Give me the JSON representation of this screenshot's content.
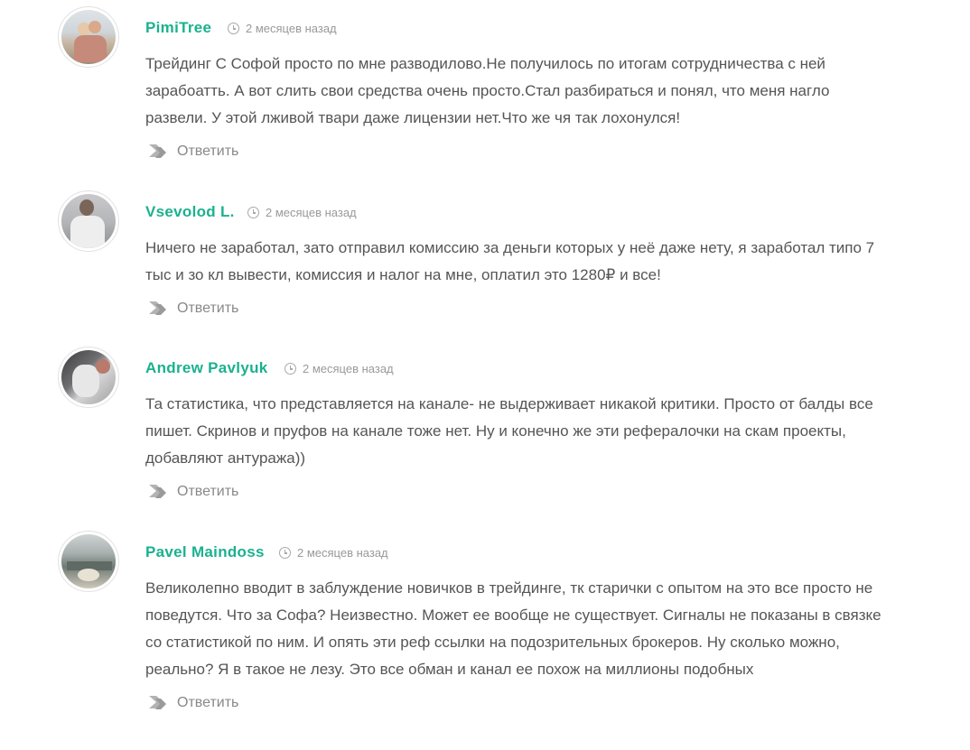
{
  "comments": [
    {
      "author": "PimiTree",
      "time": "2 месяцев назад",
      "text": "Трейдинг С Софой просто по мне разводилово.Не получилось по итогам сотрудничества с ней зарабоатть. А вот слить свои средства очень просто.Стал разбираться и понял, что меня нагло развели. У этой лживой твари даже лицензии нет.Что же чя так лохонулся!",
      "reply_label": "Ответить",
      "avatar_icon": "user-photo-avatar"
    },
    {
      "author": "Vsevolod L.",
      "time": "2 месяцев назад",
      "text": "Ничего не заработал, зато отправил комиссию за деньги которых у неё даже нету, я заработал типо 7 тыс и зо кл вывести, комиссия и налог на мне, оплатил это 1280₽ и все!",
      "reply_label": "Ответить",
      "avatar_icon": "user-photo-avatar"
    },
    {
      "author": "Andrew Pavlyuk",
      "time": "2 месяцев назад",
      "text": "Та статистика, что представляется на канале- не выдерживает никакой критики. Просто от балды все пишет. Скринов и пруфов на канале тоже нет. Ну и конечно же эти рефералочки на скам проекты, добавляют антуража))",
      "reply_label": "Ответить",
      "avatar_icon": "user-photo-avatar"
    },
    {
      "author": "Pavel Maindoss",
      "time": "2 месяцев назад",
      "text": "Великолепно вводит в заблуждение новичков в трейдинге, тк старички с опытом на это все просто не поведутся. Что за Софа? Неизвестно. Может ее вообще не существует. Сигналы не показаны в связке со статистикой по ним. И опять эти реф ссылки на подозрительных брокеров. Ну сколько можно, реально? Я в такое не лезу. Это все обман и канал ее похож на миллионы подобных",
      "reply_label": "Ответить",
      "avatar_icon": "user-photo-avatar"
    }
  ],
  "colors": {
    "author": "#1bb18f",
    "text": "#555555",
    "meta": "#999999",
    "reply": "#888888"
  }
}
